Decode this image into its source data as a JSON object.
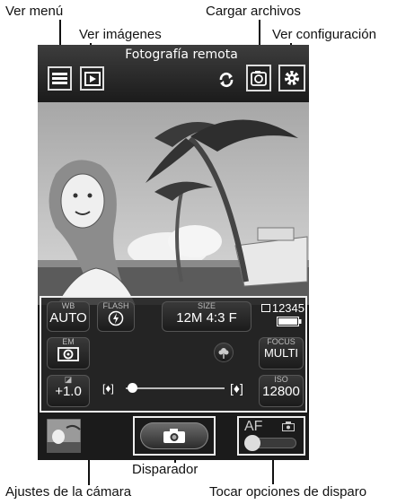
{
  "callouts": {
    "ver_menu": "Ver menú",
    "ver_imagenes": "Ver imágenes",
    "cargar_archivos": "Cargar archivos",
    "ver_configuracion": "Ver configuración",
    "disparador": "Disparador",
    "ajustes_camara": "Ajustes de la cámara",
    "tocar_opciones": "Tocar opciones de disparo"
  },
  "topbar": {
    "title": "Fotografía remota"
  },
  "settings": {
    "wb": {
      "label": "WB",
      "value": "AUTO"
    },
    "flash": {
      "label": "FLASH"
    },
    "size": {
      "label": "SIZE",
      "value": "12M 4:3 F"
    },
    "shots_remaining": "12345",
    "em": {
      "label": "EM"
    },
    "focus": {
      "label": "FOCUS",
      "value": "MULTI"
    },
    "exposure": {
      "value": "+1.0"
    },
    "iso": {
      "label": "ISO",
      "value": "12800"
    }
  },
  "touch_options": {
    "af_label": "AF"
  }
}
